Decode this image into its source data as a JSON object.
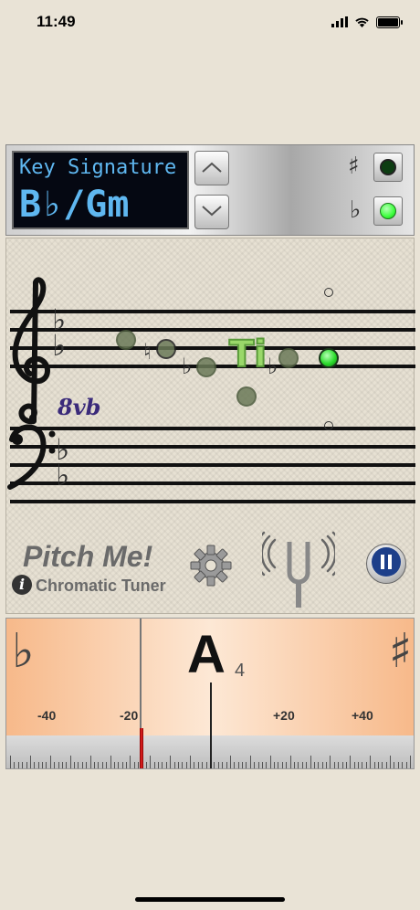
{
  "status": {
    "time": "11:49"
  },
  "key_signature": {
    "title": "Key Signature",
    "value": "B♭/Gm",
    "sharp_symbol": "♯",
    "flat_symbol": "♭",
    "sharp_led_color": "#0d3d12",
    "flat_led_color": "#3cff3c"
  },
  "staff": {
    "octave_marking": "8vb",
    "note_label": "Ti",
    "accidentals": {
      "natural": "♮",
      "flat": "♭"
    }
  },
  "app": {
    "name": "Pitch Me!",
    "subtitle": "Chromatic Tuner",
    "info_symbol": "i"
  },
  "tuner": {
    "note": "A",
    "octave": "4",
    "flat_symbol": "♭",
    "sharp_symbol": "♯",
    "cent_labels": [
      "-40",
      "-20",
      "+20",
      "+40"
    ],
    "needle_cents": -20
  }
}
